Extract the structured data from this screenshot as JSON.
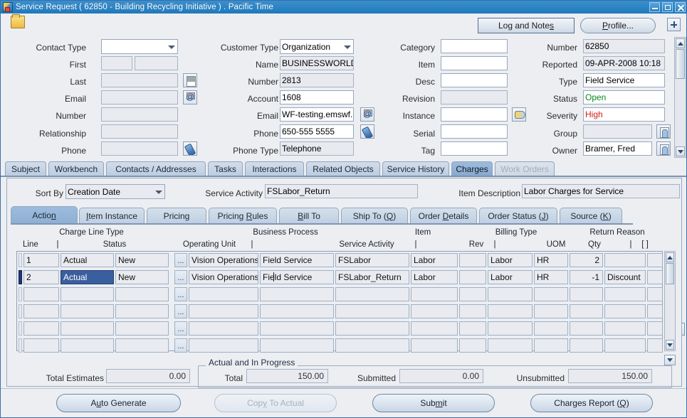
{
  "window": {
    "title": "Service Request ( 62850 - Building Recycling Initiative ) . Pacific Time",
    "icon": "app-icon",
    "minimize": "minimize-icon",
    "maximize": "maximize-icon",
    "close": "close-icon"
  },
  "toolbar": {
    "folder_icon": "folder-icon",
    "log_and_notes": "Log and Notes",
    "log_and_notes_mnemonic": "s",
    "profile": "Profile...",
    "profile_mnemonic": "P",
    "expand": "plus-icon"
  },
  "contact": {
    "labels": {
      "contact_type": "Contact Type",
      "first": "First",
      "last": "Last",
      "email": "Email",
      "number": "Number",
      "relationship": "Relationship",
      "phone": "Phone"
    },
    "values": {
      "contact_type": "",
      "first": "",
      "first_suffix": "",
      "last": "",
      "email": "",
      "number": "",
      "relationship": "",
      "phone": ""
    }
  },
  "customer": {
    "labels": {
      "customer_type": "Customer Type",
      "name": "Name",
      "number": "Number",
      "account": "Account",
      "email": "Email",
      "phone": "Phone",
      "phone_type": "Phone Type"
    },
    "values": {
      "customer_type": "Organization",
      "name": "BUSINESSWORLD",
      "number": "2813",
      "account": "1608",
      "email": "WF-testing.emswf.",
      "phone": "650-555 5555",
      "phone_type": "Telephone"
    }
  },
  "product": {
    "labels": {
      "category": "Category",
      "item": "Item",
      "desc": "Desc",
      "revision": "Revision",
      "instance": "Instance",
      "serial": "Serial",
      "tag": "Tag"
    },
    "values": {
      "category": "",
      "item": "",
      "desc": "",
      "revision": "",
      "instance": "",
      "serial": "",
      "tag": ""
    }
  },
  "request": {
    "labels": {
      "number": "Number",
      "reported": "Reported",
      "type": "Type",
      "status": "Status",
      "severity": "Severity",
      "group": "Group",
      "owner": "Owner"
    },
    "values": {
      "number": "62850",
      "reported": "09-APR-2008 10:18",
      "type": "Field Service",
      "status": "Open",
      "severity": "High",
      "group": "",
      "owner": "Bramer, Fred"
    },
    "colors": {
      "status": "#0a8a1d",
      "severity": "#d41a1a"
    }
  },
  "main_tabs": {
    "selected": "Charges",
    "items": [
      {
        "label": "Subject",
        "state": "normal"
      },
      {
        "label": "Workbench",
        "state": "normal"
      },
      {
        "label": "Contacts / Addresses",
        "state": "normal"
      },
      {
        "label": "Tasks",
        "state": "normal"
      },
      {
        "label": "Interactions",
        "state": "normal"
      },
      {
        "label": "Related Objects",
        "state": "normal"
      },
      {
        "label": "Service History",
        "state": "normal"
      },
      {
        "label": "Charges",
        "state": "selected"
      },
      {
        "label": "Work Orders",
        "state": "disabled"
      }
    ]
  },
  "charges": {
    "sort_by_label": "Sort By",
    "sort_by_value": "Creation Date",
    "service_activity_label": "Service Activity",
    "service_activity_value": "FSLabor_Return",
    "item_description_label": "Item Description",
    "item_description_value": "Labor Charges for Service"
  },
  "inner_tabs": {
    "selected": "Action",
    "items": [
      {
        "label": "Action",
        "mnemonic": "n",
        "state": "selected"
      },
      {
        "label": "Item Instance",
        "mnemonic": "I",
        "state": "normal"
      },
      {
        "label": "Pricing",
        "mnemonic": "g",
        "state": "normal"
      },
      {
        "label": "Pricing Rules",
        "mnemonic": "R",
        "state": "normal"
      },
      {
        "label": "Bill To",
        "mnemonic": "B",
        "state": "normal"
      },
      {
        "label": "Ship To (Q)",
        "mnemonic": "Q",
        "state": "normal"
      },
      {
        "label": "Order Details",
        "mnemonic": "D",
        "state": "normal"
      },
      {
        "label": "Order Status (J)",
        "mnemonic": "J",
        "state": "normal"
      },
      {
        "label": "Source (K)",
        "mnemonic": "K",
        "state": "normal"
      }
    ]
  },
  "grid": {
    "headers_top": [
      "",
      "Charge Line Type",
      "",
      "",
      "Business Process",
      "",
      "Item",
      "",
      "Billing Type",
      "",
      "Return Reason",
      ""
    ],
    "headers": [
      "Line",
      "|",
      "Status",
      "Operating Unit",
      "|",
      "Service Activity",
      "|",
      "Rev",
      "|",
      "UOM",
      "Qty",
      "|",
      "[ ]"
    ],
    "header_line": "Line",
    "header_charge_line_type": "Charge Line Type",
    "header_status": "Status",
    "header_operating_unit": "Operating Unit",
    "header_business_process": "Business Process",
    "header_service_activity": "Service Activity",
    "header_item": "Item",
    "header_rev": "Rev",
    "header_billing_type": "Billing Type",
    "header_uom": "UOM",
    "header_return_reason": "Return Reason",
    "header_qty": "Qty",
    "header_bar": "|",
    "header_bracket": "[ ]",
    "rows": [
      {
        "line": "1",
        "charge_line_type": "Actual",
        "status": "New",
        "lov": "...",
        "operating_unit": "Vision Operations",
        "business_process": "Field Service",
        "service_activity": "FSLabor",
        "item": "Labor",
        "rev": "",
        "billing_type": "Labor",
        "uom": "HR",
        "qty": "2",
        "return_reason": "",
        "extra": "",
        "selected": false,
        "active": false
      },
      {
        "line": "2",
        "charge_line_type": "Actual",
        "status": "New",
        "lov": "...",
        "operating_unit": "Vision Operations",
        "business_process": "Field Service",
        "service_activity": "FSLabor_Return",
        "item": "Labor",
        "rev": "",
        "billing_type": "Labor",
        "uom": "HR",
        "qty": "-1",
        "return_reason": "Discount",
        "extra": "",
        "selected": true,
        "active": true
      },
      {
        "line": "",
        "charge_line_type": "",
        "status": "",
        "lov": "...",
        "operating_unit": "",
        "business_process": "",
        "service_activity": "",
        "item": "",
        "rev": "",
        "billing_type": "",
        "uom": "",
        "qty": "",
        "return_reason": "",
        "extra": "",
        "selected": false,
        "active": false
      },
      {
        "line": "",
        "charge_line_type": "",
        "status": "",
        "lov": "...",
        "operating_unit": "",
        "business_process": "",
        "service_activity": "",
        "item": "",
        "rev": "",
        "billing_type": "",
        "uom": "",
        "qty": "",
        "return_reason": "",
        "extra": "",
        "selected": false,
        "active": false
      },
      {
        "line": "",
        "charge_line_type": "",
        "status": "",
        "lov": "...",
        "operating_unit": "",
        "business_process": "",
        "service_activity": "",
        "item": "",
        "rev": "",
        "billing_type": "",
        "uom": "",
        "qty": "",
        "return_reason": "",
        "extra": "",
        "selected": false,
        "active": false
      },
      {
        "line": "",
        "charge_line_type": "",
        "status": "",
        "lov": "...",
        "operating_unit": "",
        "business_process": "",
        "service_activity": "",
        "item": "",
        "rev": "",
        "billing_type": "",
        "uom": "",
        "qty": "",
        "return_reason": "",
        "extra": "",
        "selected": false,
        "active": false
      }
    ]
  },
  "totals": {
    "total_estimates_label": "Total Estimates",
    "total_estimates_value": "0.00",
    "group_title": "Actual and In Progress",
    "total_label": "Total",
    "total_value": "150.00",
    "submitted_label": "Submitted",
    "submitted_value": "0.00",
    "unsubmitted_label": "Unsubmitted",
    "unsubmitted_value": "150.00"
  },
  "footer": {
    "auto_generate": "Auto Generate",
    "auto_generate_mnemonic": "u",
    "copy_to_actual": "Copy To Actual",
    "copy_to_actual_state": "disabled",
    "submit": "Submit",
    "submit_mnemonic": "m",
    "charges_report": "Charges Report (Q)",
    "charges_report_mnemonic": "Q"
  }
}
